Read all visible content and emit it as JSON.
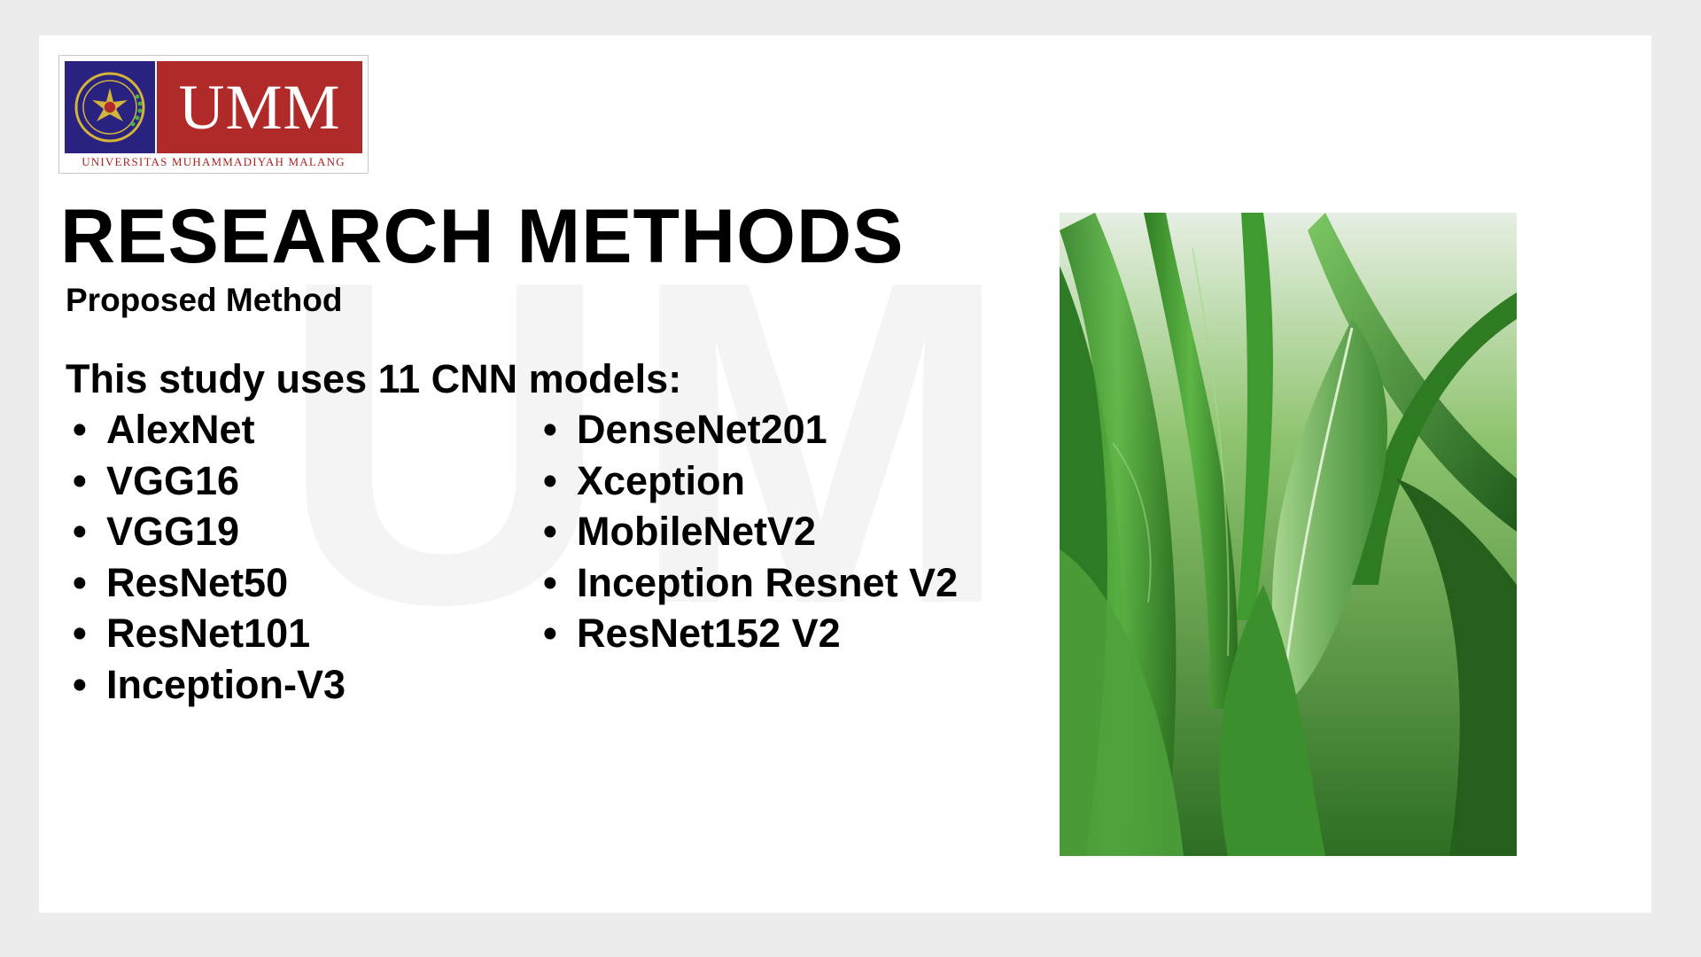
{
  "slide": {
    "watermark": "UMM",
    "logo": {
      "wordmark": "UMM",
      "subtitle": "UNIVERSITAS MUHAMMADIYAH MALANG",
      "seal_text": "UNIVERSITAS MUHAMMADIYAH MALANG",
      "colors": {
        "left_panel": "#2a2280",
        "right_panel": "#b02a2a",
        "subtitle": "#a72424"
      }
    },
    "title": "RESEARCH METHODS",
    "subtitle": "Proposed Method",
    "intro": "This study uses 11 CNN models:",
    "models_left": [
      "AlexNet",
      "VGG16",
      "VGG19",
      "ResNet50",
      "ResNet101",
      "Inception-V3"
    ],
    "models_right": [
      "DenseNet201",
      "Xception",
      "MobileNetV2",
      "Inception Resnet V2",
      "ResNet152 V2"
    ],
    "bullet": "•",
    "photo": {
      "subject": "corn-leaves-photo",
      "colors": {
        "leaf": "#3c9a2c",
        "dark": "#1f5a1a",
        "light": "#9ed080",
        "sky": "#e8f0e6"
      }
    }
  }
}
